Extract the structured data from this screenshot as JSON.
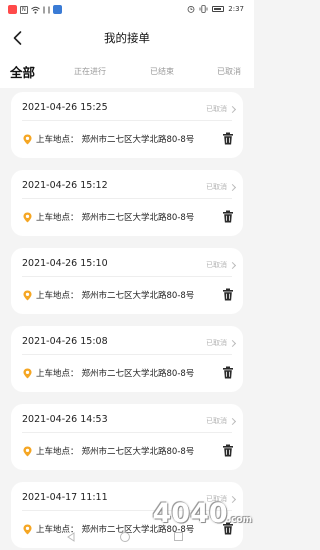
{
  "status_bar": {
    "left_icons": [
      "app-icon-red",
      "nfc-icon",
      "wifi-icon",
      "speed-icon",
      "app-icon-blue"
    ],
    "right_icons": [
      "alarm-icon",
      "vibrate-icon",
      "battery-icon"
    ],
    "nfc": "N",
    "time": "2:37"
  },
  "header": {
    "title": "我的接单"
  },
  "tabs": [
    {
      "label": "全部",
      "active": true
    },
    {
      "label": "正在进行",
      "active": false
    },
    {
      "label": "已结束",
      "active": false
    },
    {
      "label": "已取消",
      "active": false
    }
  ],
  "orders": [
    {
      "time": "2021-04-26 15:25",
      "status": "已取消",
      "address_label": "上车地点：",
      "address": "郑州市二七区大学北路80-8号"
    },
    {
      "time": "2021-04-26 15:12",
      "status": "已取消",
      "address_label": "上车地点：",
      "address": "郑州市二七区大学北路80-8号"
    },
    {
      "time": "2021-04-26 15:10",
      "status": "已取消",
      "address_label": "上车地点：",
      "address": "郑州市二七区大学北路80-8号"
    },
    {
      "time": "2021-04-26 15:08",
      "status": "已取消",
      "address_label": "上车地点：",
      "address": "郑州市二七区大学北路80-8号"
    },
    {
      "time": "2021-04-26 14:53",
      "status": "已取消",
      "address_label": "上车地点：",
      "address": "郑州市二七区大学北路80-8号"
    },
    {
      "time": "2021-04-17 11:11",
      "status": "已取消",
      "address_label": "上车地点：",
      "address": "郑州市二七区大学北路80-8号"
    }
  ],
  "colors": {
    "pin": "#f5a623",
    "background": "#f4f4f4",
    "status_text": "#b3b3b3"
  },
  "watermark": {
    "text": "4040",
    "suffix": ".com"
  }
}
